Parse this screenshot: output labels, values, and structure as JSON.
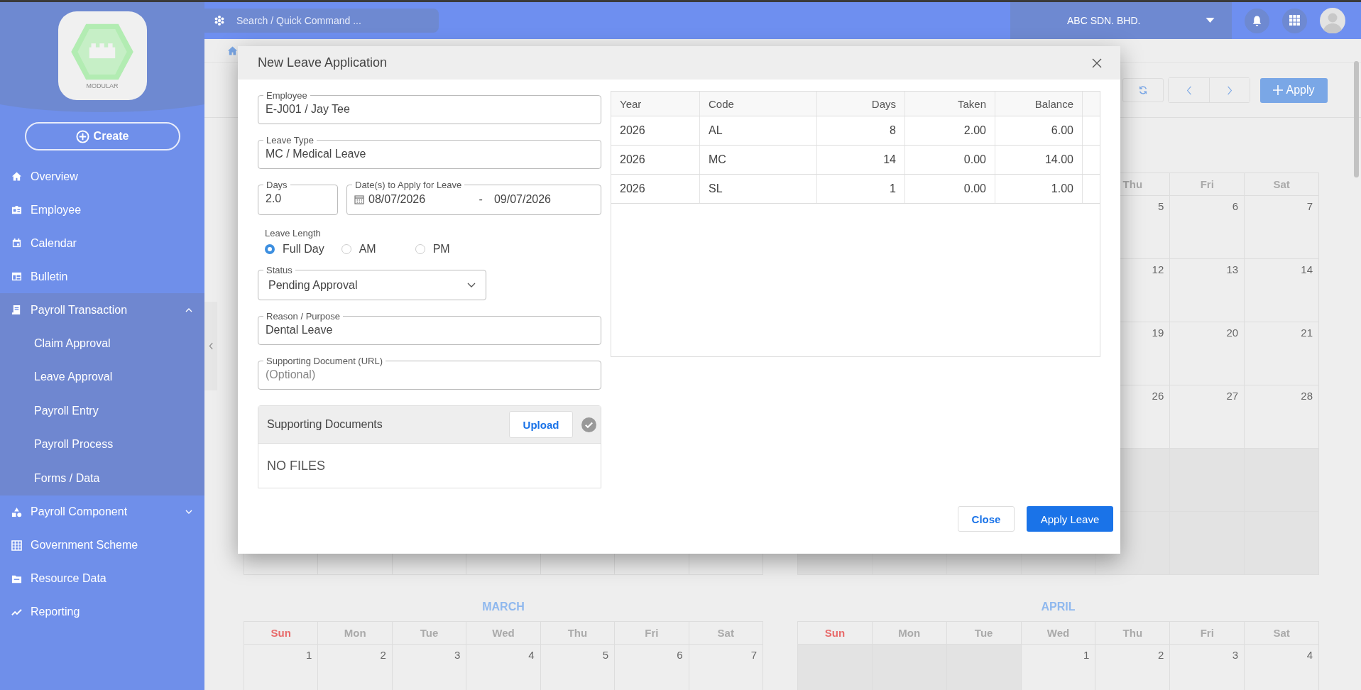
{
  "sidebar": {
    "logo_caption": "MODULAR",
    "create": "Create",
    "items": [
      {
        "label": "Overview",
        "kind": "link"
      },
      {
        "label": "Employee",
        "kind": "link"
      },
      {
        "label": "Calendar",
        "kind": "link"
      },
      {
        "label": "Bulletin",
        "kind": "link"
      },
      {
        "label": "Payroll Transaction",
        "kind": "group",
        "expanded": true,
        "children": [
          {
            "label": "Claim Approval"
          },
          {
            "label": "Leave Approval"
          },
          {
            "label": "Payroll Entry"
          },
          {
            "label": "Payroll Process"
          },
          {
            "label": "Forms / Data"
          }
        ]
      },
      {
        "label": "Payroll Component",
        "kind": "group",
        "expanded": false
      },
      {
        "label": "Government Scheme",
        "kind": "link"
      },
      {
        "label": "Resource Data",
        "kind": "link"
      },
      {
        "label": "Reporting",
        "kind": "link"
      }
    ]
  },
  "topbar": {
    "search": {
      "placeholder": "Search / Quick Command ..."
    },
    "company": "ABC SDN. BHD."
  },
  "page_header": {
    "apply_button": "Apply"
  },
  "calendars": [
    {
      "kind": "covered",
      "weeks": [
        {
          "cells": [
            {
              "kind": "empty"
            },
            {
              "kind": "empty"
            },
            {
              "kind": "empty"
            },
            {
              "kind": "empty"
            },
            {
              "kind": "empty"
            },
            {
              "kind": "empty"
            },
            {
              "kind": "empty"
            }
          ]
        }
      ]
    },
    {
      "weekdays": [
        {
          "label": "Thu",
          "weekend": false
        },
        {
          "label": "Fri",
          "weekend": false
        },
        {
          "label": "Sat",
          "weekend": false
        }
      ],
      "weeks": [
        {
          "cells": [
            {
              "kind": "day",
              "day": "5"
            },
            {
              "kind": "day",
              "day": "6"
            },
            {
              "kind": "day",
              "day": "7"
            }
          ]
        },
        {
          "cells": [
            {
              "kind": "day",
              "day": "12"
            },
            {
              "kind": "day",
              "day": "13"
            },
            {
              "kind": "day",
              "day": "14"
            }
          ]
        },
        {
          "cells": [
            {
              "kind": "day",
              "day": "19"
            },
            {
              "kind": "day",
              "day": "20"
            },
            {
              "kind": "day",
              "day": "21"
            }
          ]
        },
        {
          "cells": [
            {
              "kind": "day",
              "day": "26"
            },
            {
              "kind": "day",
              "day": "27"
            },
            {
              "kind": "day",
              "day": "28"
            }
          ]
        },
        {
          "cells": [
            {
              "kind": "blank"
            },
            {
              "kind": "blank"
            },
            {
              "kind": "blank"
            }
          ]
        },
        {
          "cells": [
            {
              "kind": "blank"
            },
            {
              "kind": "blank"
            },
            {
              "kind": "blank"
            },
            {
              "kind": "blank"
            },
            {
              "kind": "blank"
            },
            {
              "kind": "blank"
            },
            {
              "kind": "blank"
            }
          ]
        }
      ]
    },
    {
      "title": "MARCH",
      "weekdays": [
        {
          "label": "Sun",
          "weekend": true
        },
        {
          "label": "Mon",
          "weekend": false
        },
        {
          "label": "Tue",
          "weekend": false
        },
        {
          "label": "Wed",
          "weekend": false
        },
        {
          "label": "Thu",
          "weekend": false
        },
        {
          "label": "Fri",
          "weekend": false
        },
        {
          "label": "Sat",
          "weekend": false
        }
      ],
      "weeks": [
        {
          "cells": [
            {
              "kind": "day",
              "day": "1"
            },
            {
              "kind": "day",
              "day": "2"
            },
            {
              "kind": "day",
              "day": "3"
            },
            {
              "kind": "day",
              "day": "4"
            },
            {
              "kind": "day",
              "day": "5"
            },
            {
              "kind": "day",
              "day": "6"
            },
            {
              "kind": "day",
              "day": "7"
            }
          ]
        }
      ]
    },
    {
      "title": "APRIL",
      "weekdays": [
        {
          "label": "Sun",
          "weekend": true
        },
        {
          "label": "Mon",
          "weekend": false
        },
        {
          "label": "Tue",
          "weekend": false
        },
        {
          "label": "Wed",
          "weekend": false
        },
        {
          "label": "Thu",
          "weekend": false
        },
        {
          "label": "Fri",
          "weekend": false
        },
        {
          "label": "Sat",
          "weekend": false
        }
      ],
      "weeks": [
        {
          "cells": [
            {
              "kind": "blank"
            },
            {
              "kind": "blank"
            },
            {
              "kind": "blank"
            },
            {
              "kind": "day",
              "day": "1"
            },
            {
              "kind": "day",
              "day": "2"
            },
            {
              "kind": "day",
              "day": "3"
            },
            {
              "kind": "day",
              "day": "4"
            }
          ]
        }
      ]
    }
  ],
  "dialog": {
    "title": "New Leave Application",
    "employee": {
      "label": "Employee",
      "value": "E-J001 / Jay Tee"
    },
    "leave_type": {
      "label": "Leave Type",
      "value": "MC / Medical Leave"
    },
    "days": {
      "label": "Days",
      "value": "2.0"
    },
    "dates": {
      "label": "Date(s) to Apply for Leave",
      "from": "08/07/2026",
      "separator": "-",
      "to": "09/07/2026"
    },
    "leave_length": {
      "label": "Leave Length",
      "options": [
        {
          "label": "Full Day",
          "selected": true
        },
        {
          "label": "AM",
          "selected": false
        },
        {
          "label": "PM",
          "selected": false
        }
      ]
    },
    "status": {
      "label": "Status",
      "value": "Pending Approval"
    },
    "reason": {
      "label": "Reason / Purpose",
      "value": "Dental Leave"
    },
    "document_url": {
      "label": "Supporting Document (URL)",
      "placeholder": "(Optional)"
    },
    "documents": {
      "title": "Supporting Documents",
      "upload": "Upload",
      "empty": "NO FILES"
    },
    "balance_table": {
      "columns": [
        {
          "label": "Year",
          "numeric": false
        },
        {
          "label": "Code",
          "numeric": false
        },
        {
          "label": "Days",
          "numeric": true
        },
        {
          "label": "Taken",
          "numeric": true
        },
        {
          "label": "Balance",
          "numeric": true
        }
      ],
      "rows": [
        [
          "2026",
          "AL",
          "8",
          "2.00",
          "6.00"
        ],
        [
          "2026",
          "MC",
          "14",
          "0.00",
          "14.00"
        ],
        [
          "2026",
          "SL",
          "1",
          "0.00",
          "1.00"
        ]
      ]
    },
    "buttons": {
      "close": "Close",
      "apply": "Apply Leave"
    }
  }
}
